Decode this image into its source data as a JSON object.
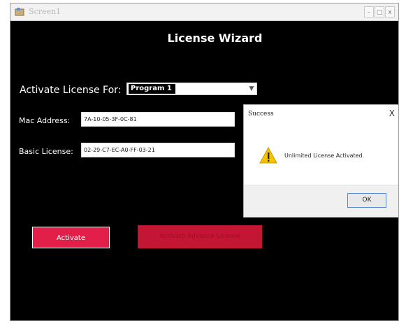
{
  "window": {
    "title": "Screen1",
    "controls": {
      "minimize": "–",
      "maximize": "□",
      "close": "x"
    }
  },
  "wizard": {
    "heading": "License Wizard",
    "activate_for_label": "Activate License For:",
    "activate_for_value": "Program 1",
    "mac_label": "Mac Address:",
    "mac_value": "7A-10-05-3F-0C-81",
    "basic_label": "Basic License:",
    "basic_value": "02-29-C7-EC-A0-FF-03-21",
    "activate_button": "Activate",
    "advance_button": "Activate Advance License"
  },
  "dialog": {
    "title": "Success",
    "close": "X",
    "message": "Unlimited License Activated.",
    "ok_button": "OK",
    "icon": "warning-icon"
  },
  "colors": {
    "background": "#000000",
    "accent": "#e21f49",
    "accent_disabled": "#c31634",
    "warning": "#f5c400"
  }
}
